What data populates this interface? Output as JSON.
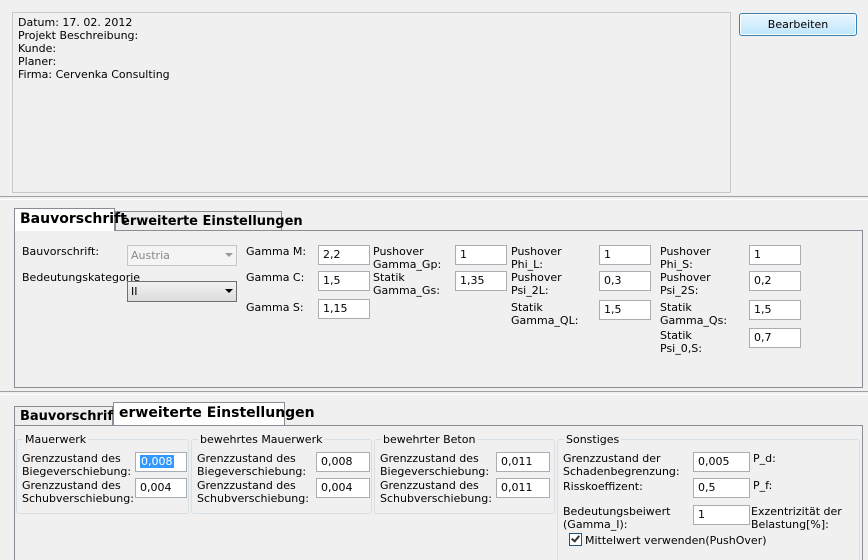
{
  "info": {
    "datum": "Datum: 17. 02. 2012",
    "projekt": "Projekt Beschreibung:",
    "kunde": "Kunde:",
    "planer": "Planer:",
    "firma": "Firma: Cervenka Consulting"
  },
  "edit_button": "Bearbeiten",
  "tabs": {
    "bauvorschrift": "Bauvorschrift",
    "erweitert": "erweiterte Einstellungen"
  },
  "panel1": {
    "bauvorschrift_label": "Bauvorschrift:",
    "bauvorschrift_value": "Austria",
    "bedeutung_label": "Bedeutungskategorie",
    "bedeutung_value": "II",
    "gamma_m_label": "Gamma M:",
    "gamma_m": "2,2",
    "gamma_c_label": "Gamma C:",
    "gamma_c": "1,5",
    "gamma_s_label": "Gamma S:",
    "gamma_s": "1,15",
    "po_gamma_gp_label1": "Pushover",
    "po_gamma_gp_label2": "Gamma_Gp:",
    "po_gamma_gp": "1",
    "st_gamma_gs_label1": "Statik",
    "st_gamma_gs_label2": "Gamma_Gs:",
    "st_gamma_gs": "1,35",
    "po_phi_l_label1": "Pushover",
    "po_phi_l_label2": "Phi_L:",
    "po_phi_l": "1",
    "po_psi_2l_label1": "Pushover",
    "po_psi_2l_label2": "Psi_2L:",
    "po_psi_2l": "0,3",
    "st_gamma_ql_label1": "Statik",
    "st_gamma_ql_label2": "Gamma_QL:",
    "st_gamma_ql": "1,5",
    "po_phi_s_label1": "Pushover",
    "po_phi_s_label2": "Phi_S:",
    "po_phi_s": "1",
    "po_psi_2s_label1": "Pushover",
    "po_psi_2s_label2": "Psi_2S:",
    "po_psi_2s": "0,2",
    "st_gamma_qs_label1": "Statik",
    "st_gamma_qs_label2": "Gamma_Qs:",
    "st_gamma_qs": "1,5",
    "st_psi_0s_label1": "Statik",
    "st_psi_0s_label2": "Psi_0,S:",
    "st_psi_0s": "0,7"
  },
  "panel2": {
    "mauerwerk": {
      "title": "Mauerwerk",
      "biege1": "Grenzzustand des",
      "biege2": "Biegeverschiebung:",
      "biege": "0,008",
      "schub1": "Grenzzustand des",
      "schub2": "Schubverschiebung:",
      "schub": "0,004"
    },
    "bewehrtes_mauerwerk": {
      "title": "bewehrtes Mauerwerk",
      "biege1": "Grenzzustand des",
      "biege2": "Biegeverschiebung:",
      "biege": "0,008",
      "schub1": "Grenzzustand des",
      "schub2": "Schubverschiebung:",
      "schub": "0,004"
    },
    "bewehrter_beton": {
      "title": "bewehrter Beton",
      "biege1": "Grenzzustand des",
      "biege2": "Biegeverschiebung:",
      "biege": "0,011",
      "schub1": "Grenzzustand des",
      "schub2": "Schubverschiebung:",
      "schub": "0,011"
    },
    "sonstiges": {
      "title": "Sonstiges",
      "schaden1": "Grenzzustand der",
      "schaden2": "Schadenbegrenzung:",
      "schaden": "0,005",
      "pd": "P_d:",
      "risiko": "Risskoeffizent:",
      "risiko_value": "0,5",
      "pf": "P_f:",
      "bedeutung1": "Bedeutungsbeiwert",
      "bedeutung2": "(Gamma_I):",
      "bedeutung": "1",
      "exz1": "Exzentrizität der",
      "exz2": "Belastung[%]:",
      "mittelwert": "Mittelwert verwenden(PushOver)",
      "mittelwert_checked": true
    }
  }
}
